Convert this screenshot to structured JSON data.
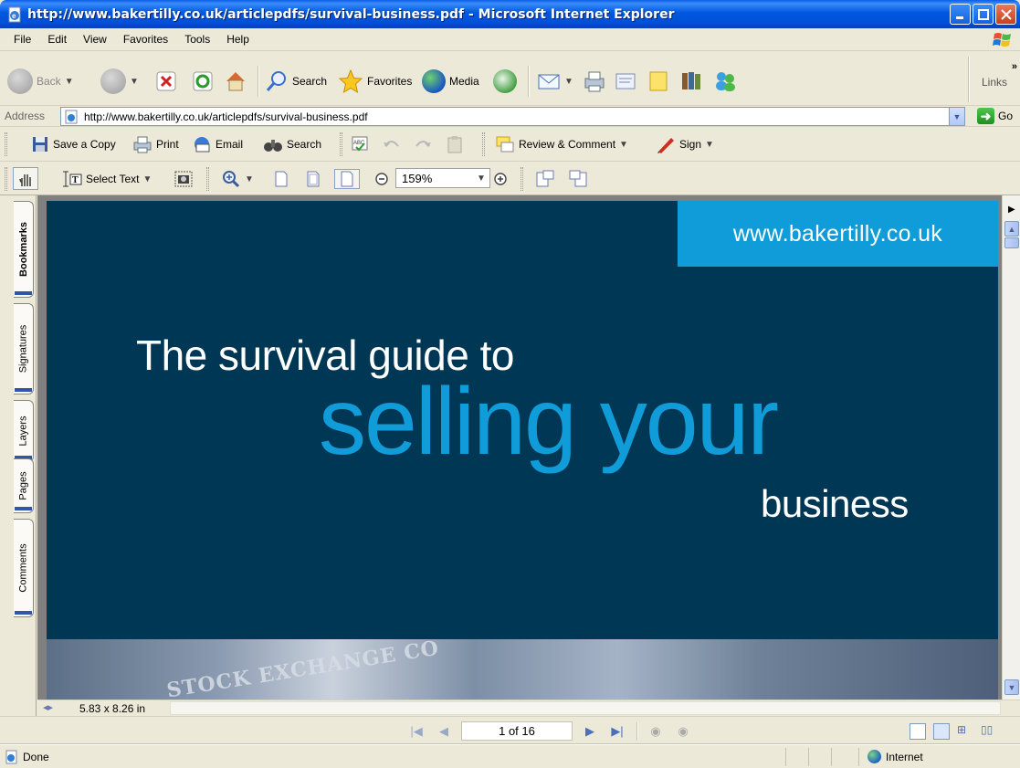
{
  "window": {
    "title": "http://www.bakertilly.co.uk/articlepdfs/survival-business.pdf - Microsoft Internet Explorer"
  },
  "menu": [
    "File",
    "Edit",
    "View",
    "Favorites",
    "Tools",
    "Help"
  ],
  "toolbar": {
    "back": "Back",
    "search": "Search",
    "favorites": "Favorites",
    "media": "Media",
    "links": "Links"
  },
  "address": {
    "label": "Address",
    "url": "http://www.bakertilly.co.uk/articlepdfs/survival-business.pdf",
    "go": "Go"
  },
  "acrobat": {
    "save_copy": "Save a Copy",
    "print": "Print",
    "email": "Email",
    "search": "Search",
    "review": "Review & Comment",
    "sign": "Sign",
    "select_text": "Select Text",
    "zoom": "159%"
  },
  "nav_tabs": [
    "Bookmarks",
    "Signatures",
    "Layers",
    "Pages",
    "Comments"
  ],
  "document": {
    "url": "www.bakertilly.co.uk",
    "line1": "The survival guide to",
    "line2": "selling your",
    "line3": "business",
    "photo_text": "STOCK EXCHANGE CO"
  },
  "page_size": "5.83 x 8.26 in",
  "page_indicator": "1 of 16",
  "status": {
    "text": "Done",
    "zone": "Internet"
  }
}
